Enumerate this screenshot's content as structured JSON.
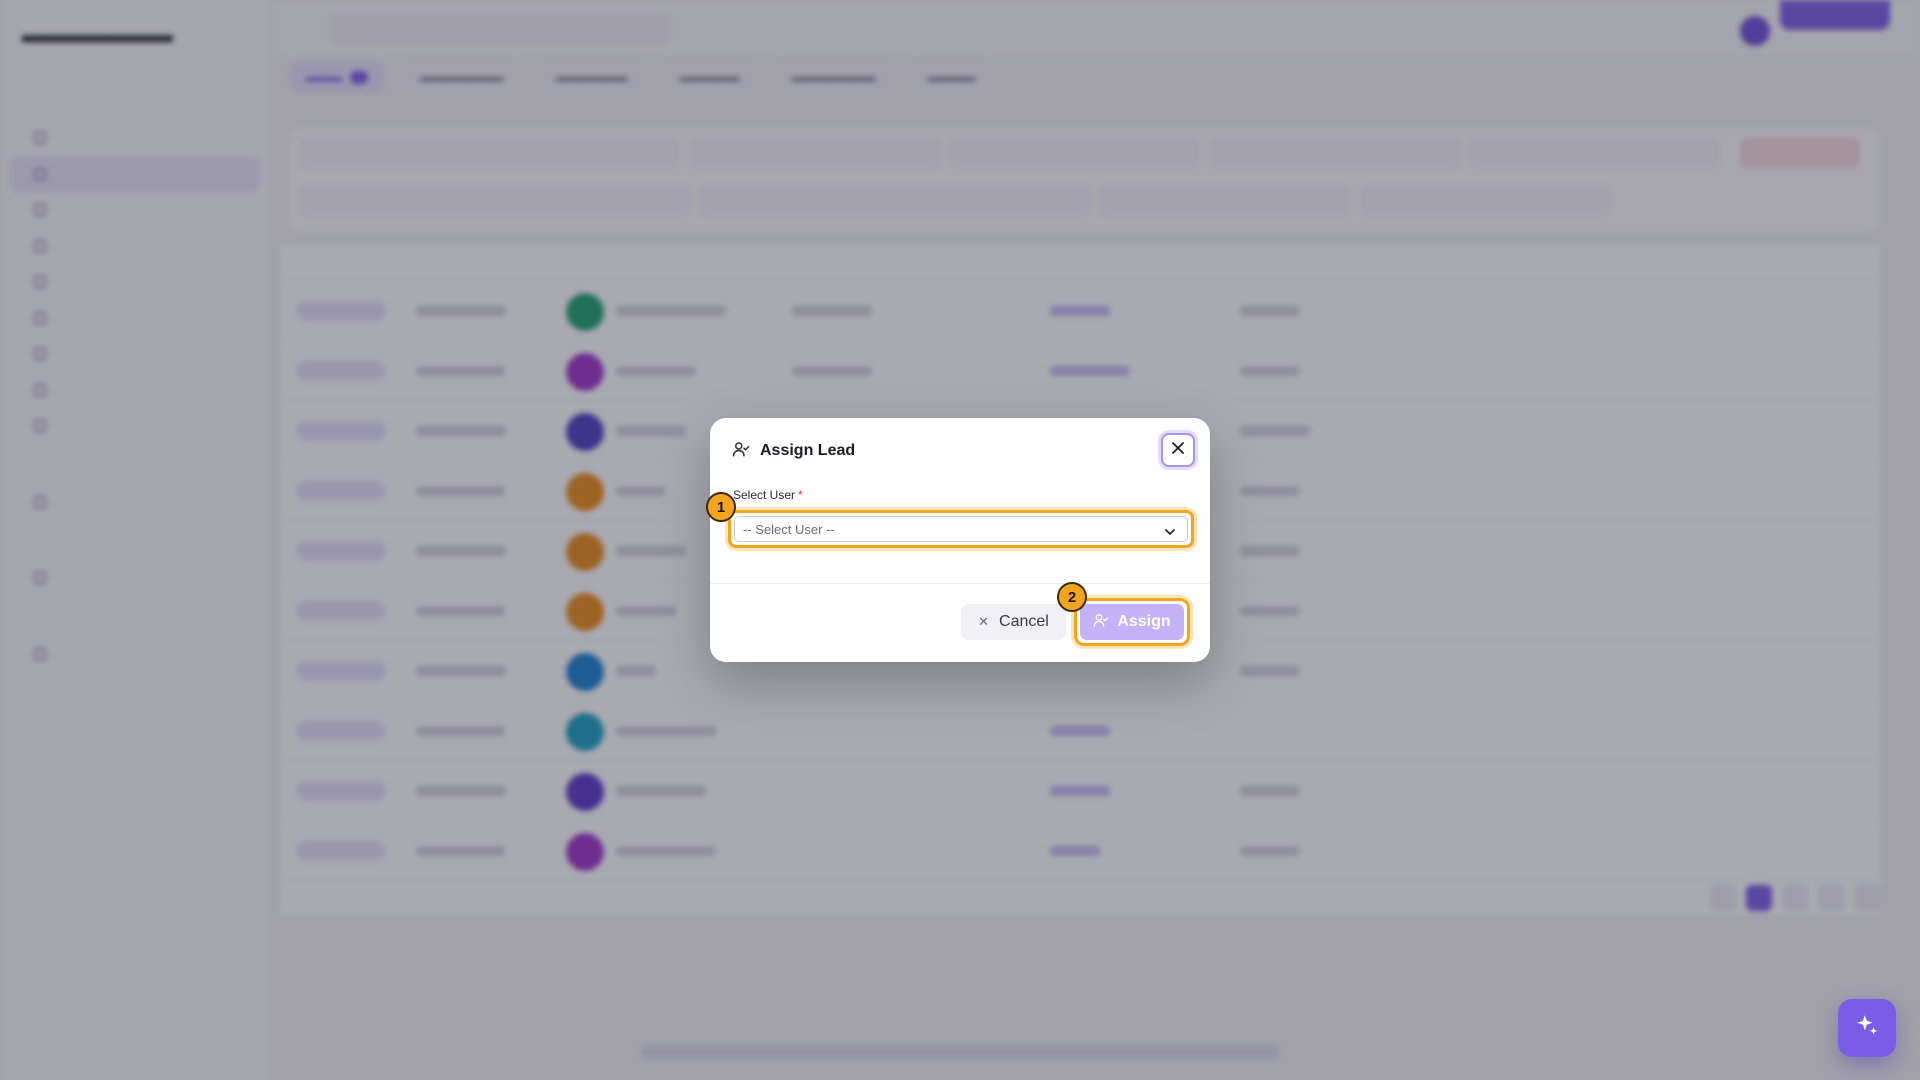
{
  "modal": {
    "title": "Assign Lead",
    "field_label": "Select User",
    "required_mark": "*",
    "select_placeholder": "-- Select User --",
    "cancel_label": "Cancel",
    "assign_label": "Assign"
  },
  "annotations": [
    "1",
    "2"
  ],
  "icons": {
    "title": "user-assign-icon",
    "close": "close-icon",
    "chevron": "chevron-down-icon",
    "cancel": "x-icon",
    "assign": "user-assign-icon",
    "fab": "sparkles-icon"
  },
  "colors": {
    "accent": "#7b5ce6",
    "highlight": "#f5a51c",
    "assign_disabled": "#c3b3f6",
    "required": "#e03a3a"
  }
}
